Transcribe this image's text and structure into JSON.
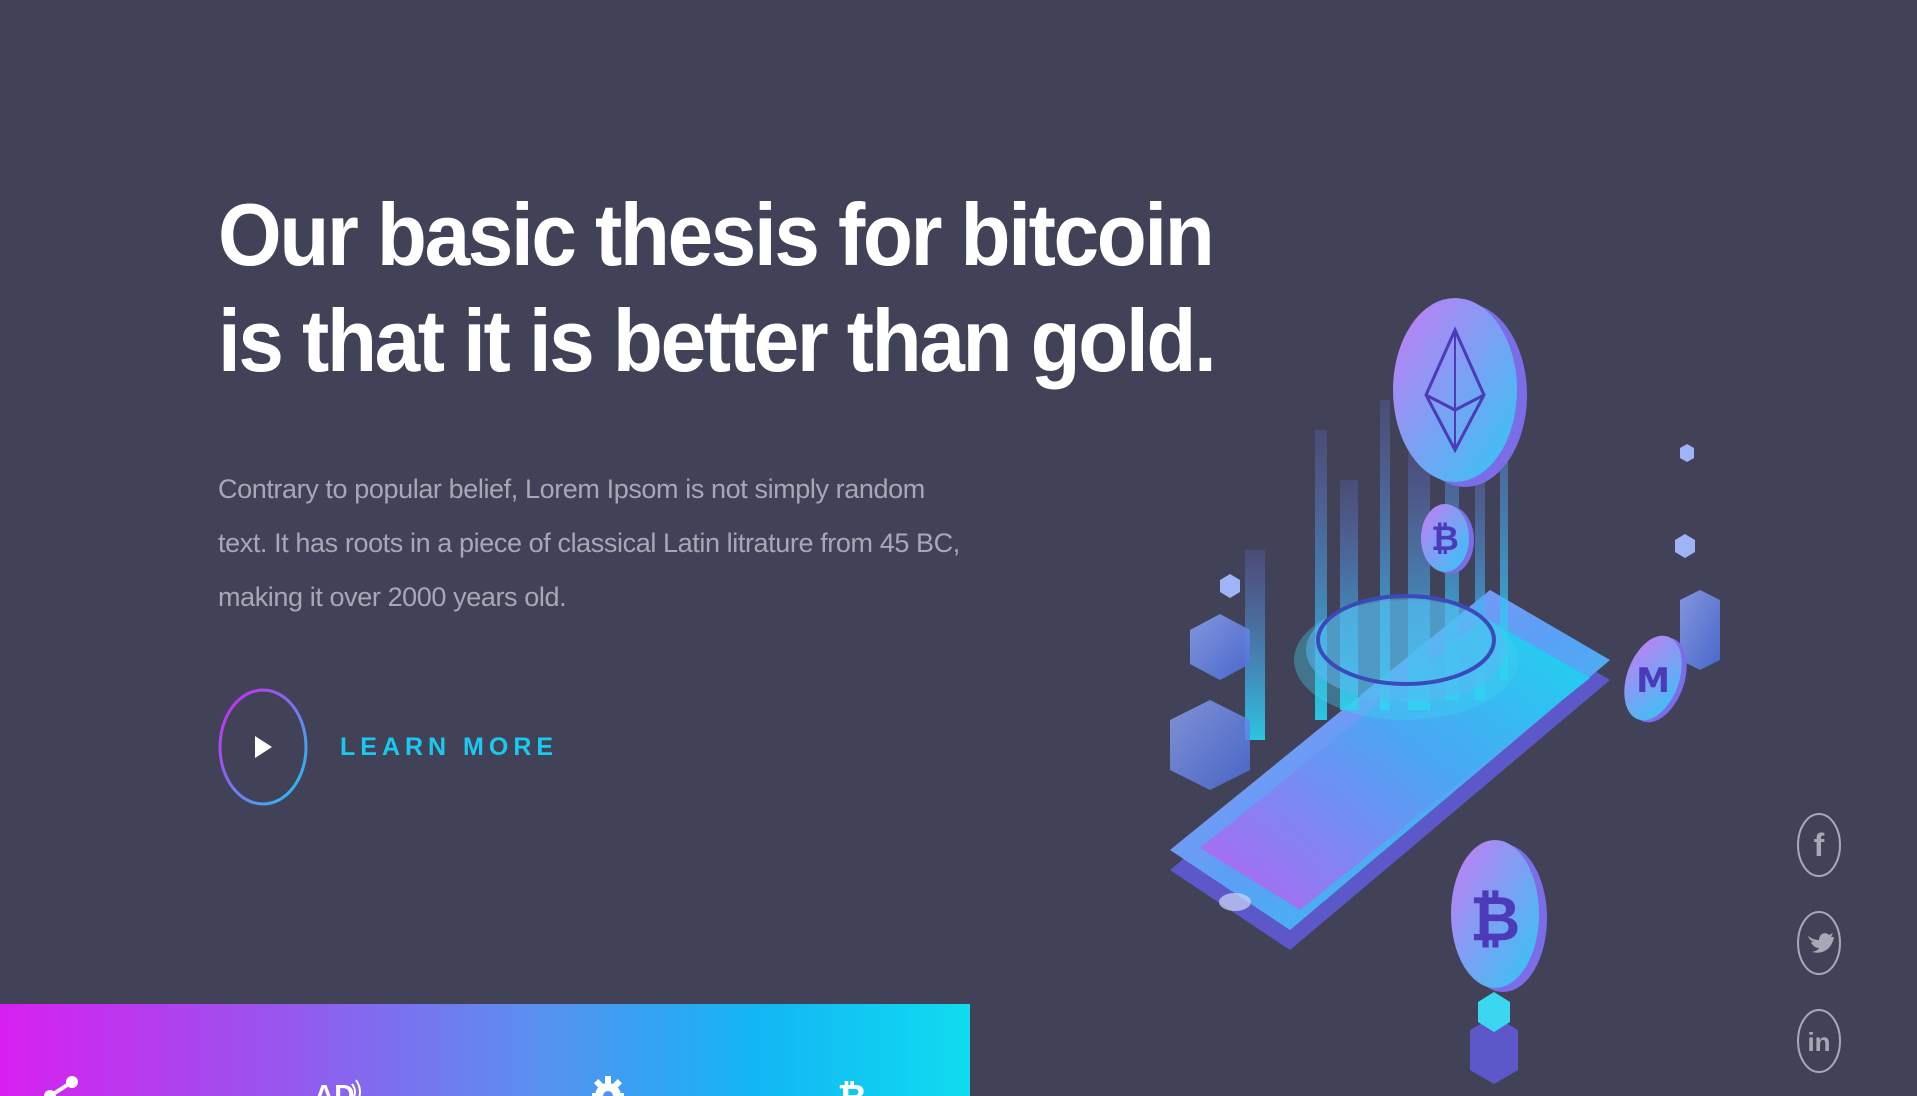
{
  "hero": {
    "title_line1": "Our basic thesis for bitcoin",
    "title_line2": "is that it is better than gold.",
    "text_line1": "Contrary to popular belief, Lorem Ipsom is not simply random",
    "text_line2": "text. It has roots in a piece of classical Latin litrature from 45 BC,",
    "text_line3": "making it over 2000 years old.",
    "cta_label": "LEARN MORE"
  },
  "social": {
    "items": [
      {
        "icon": "facebook-icon",
        "glyph": "f"
      },
      {
        "icon": "twitter-icon",
        "glyph": "bird"
      },
      {
        "icon": "linkedin-icon",
        "glyph": "in"
      }
    ]
  },
  "features_bar": {
    "icons": [
      "share-icon",
      "ad-icon",
      "gear-icon",
      "bitcoin-icon"
    ]
  },
  "illustration": {
    "icon": "crypto-isometric-illustration",
    "coins": [
      "ethereum",
      "bitcoin",
      "monero",
      "bitcoin"
    ]
  },
  "colors": {
    "background": "#414257",
    "accent": "#19c9f0",
    "gradient_start": "#d81ff0",
    "gradient_end": "#0fdcf0",
    "body_text": "#a7a8b6"
  }
}
